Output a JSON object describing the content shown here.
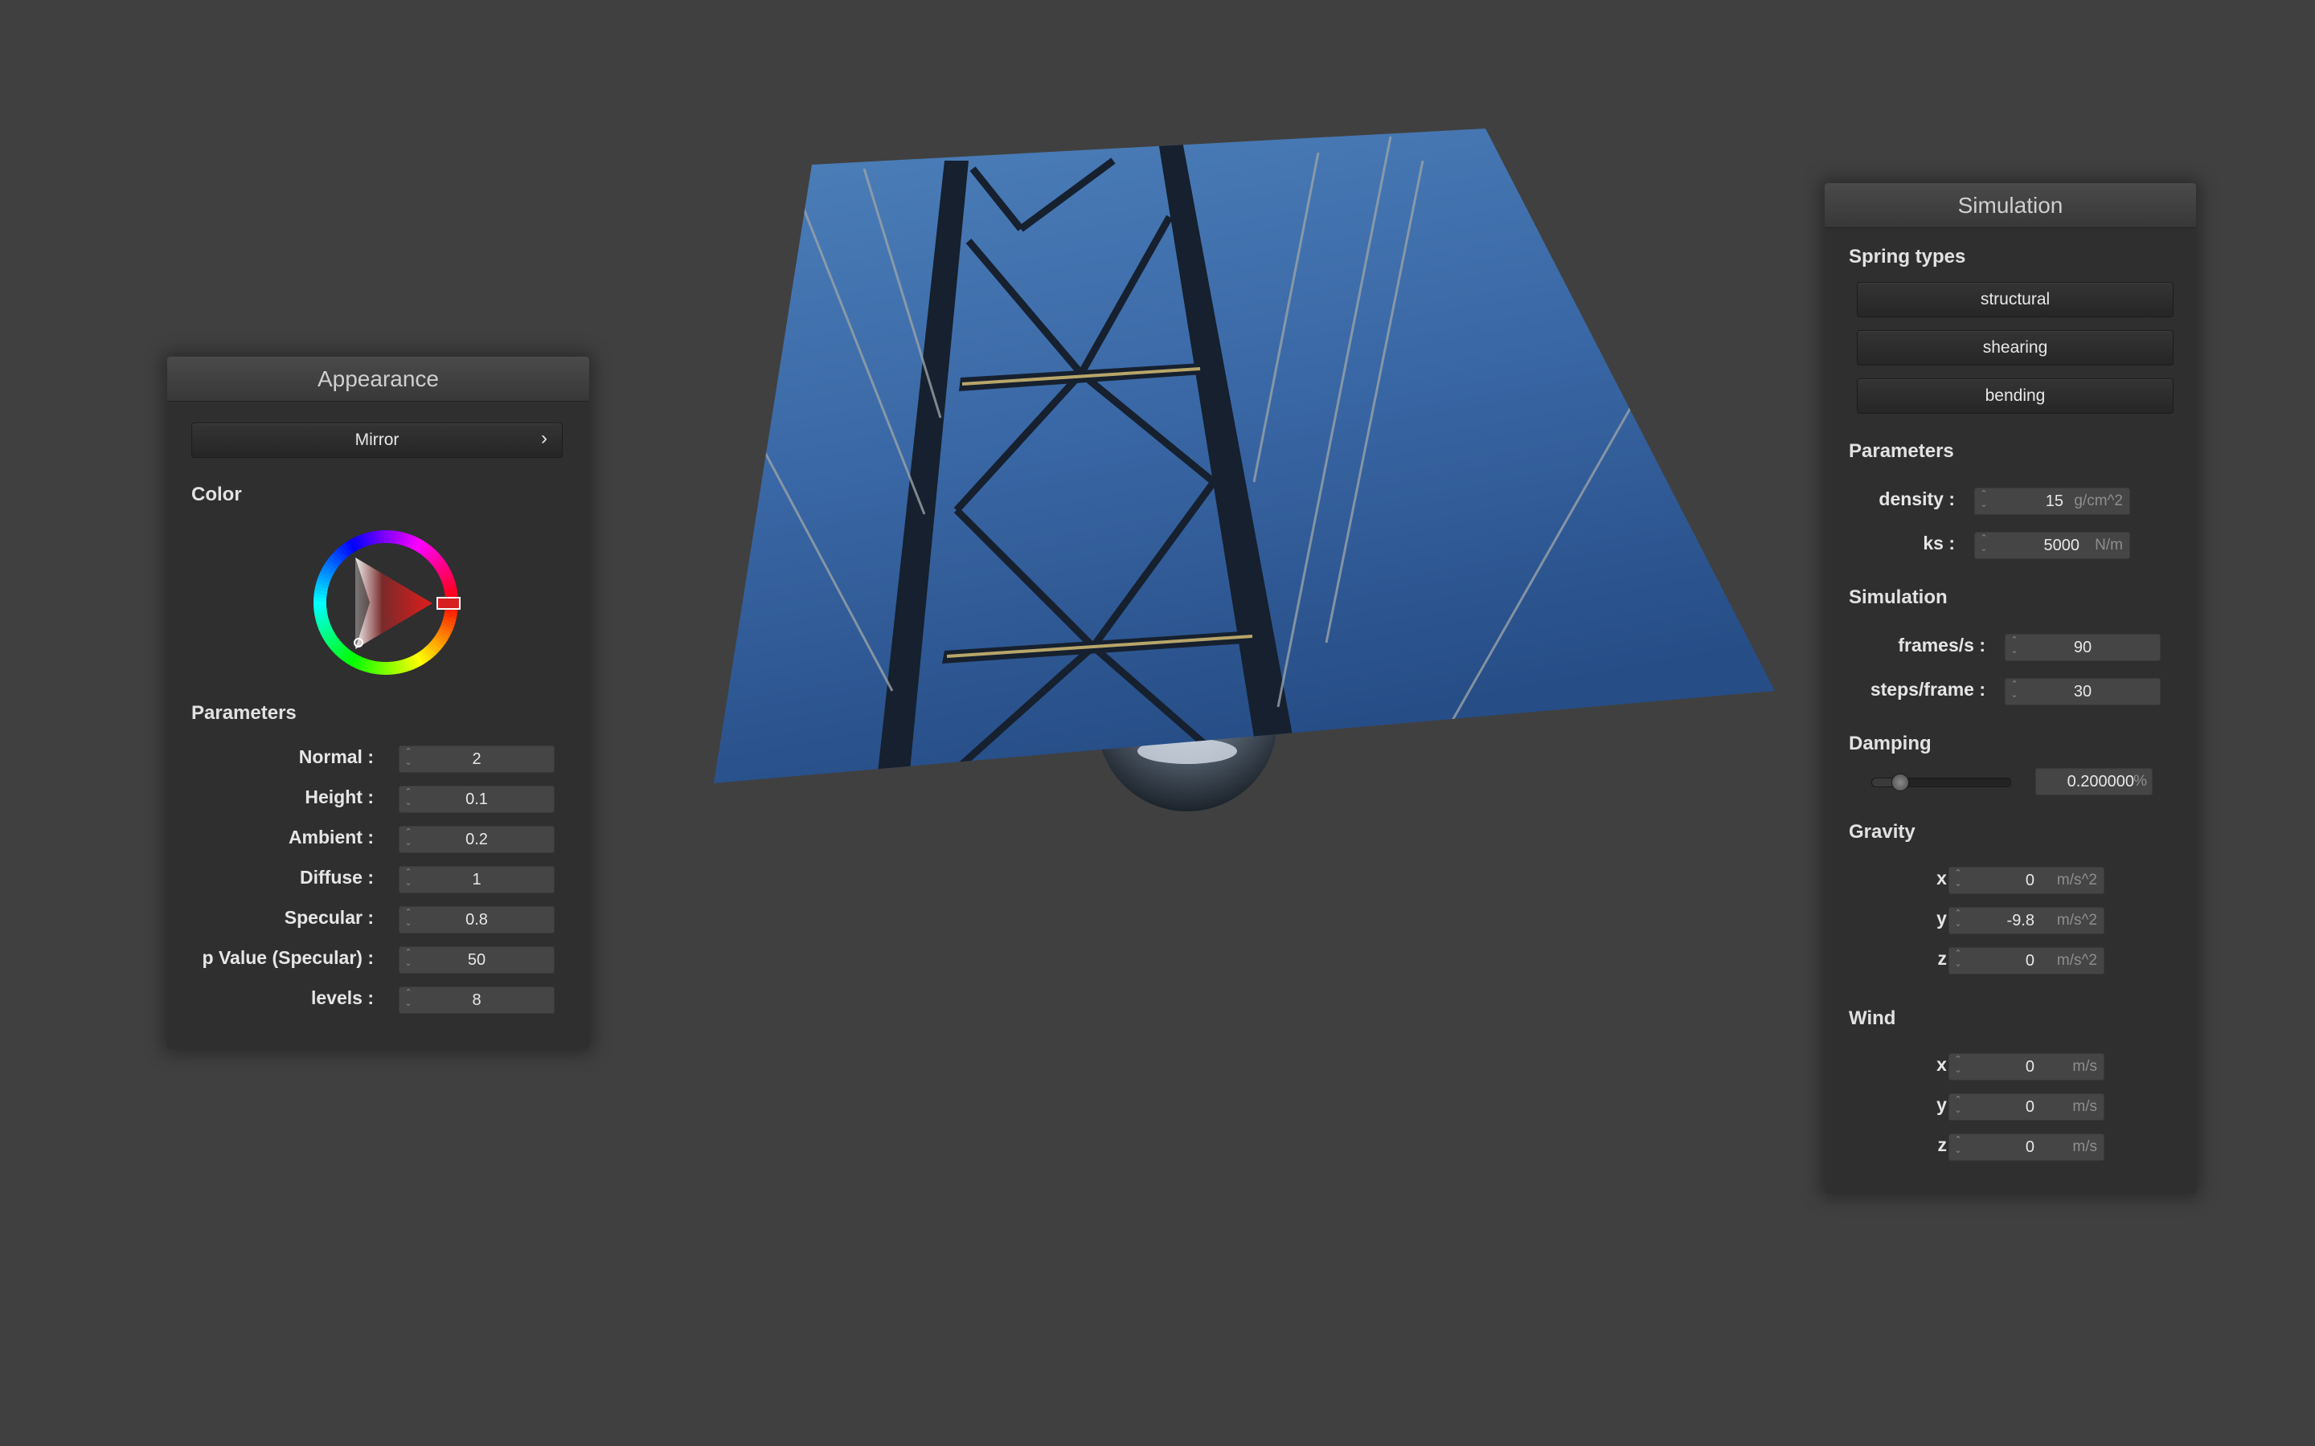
{
  "appearance": {
    "title": "Appearance",
    "mode_label": "Mirror",
    "mode_chevron": "›",
    "color_section": "Color",
    "parameters_section": "Parameters",
    "params": [
      {
        "label": "Normal :",
        "value": "2"
      },
      {
        "label": "Height :",
        "value": "0.1"
      },
      {
        "label": "Ambient :",
        "value": "0.2"
      },
      {
        "label": "Diffuse :",
        "value": "1"
      },
      {
        "label": "Specular :",
        "value": "0.8"
      },
      {
        "label": "p Value (Specular) :",
        "value": "50"
      },
      {
        "label": "levels :",
        "value": "8"
      }
    ],
    "selected_color": "#d62020"
  },
  "simulation": {
    "title": "Simulation",
    "spring_section": "Spring types",
    "spring_buttons": [
      "structural",
      "shearing",
      "bending"
    ],
    "parameters_section": "Parameters",
    "density": {
      "label": "density :",
      "value": "15",
      "unit": "g/cm^2"
    },
    "ks": {
      "label": "ks :",
      "value": "5000",
      "unit": "N/m"
    },
    "sim_section": "Simulation",
    "fps": {
      "label": "frames/s :",
      "value": "90"
    },
    "steps": {
      "label": "steps/frame :",
      "value": "30"
    },
    "damping_section": "Damping",
    "damping": {
      "value": "0.200000",
      "unit": "%",
      "level": 0.2
    },
    "gravity_section": "Gravity",
    "gravity": [
      {
        "label": "x :",
        "value": "0",
        "unit": "m/s^2"
      },
      {
        "label": "y :",
        "value": "-9.8",
        "unit": "m/s^2"
      },
      {
        "label": "z :",
        "value": "0",
        "unit": "m/s^2"
      }
    ],
    "wind_section": "Wind",
    "wind": [
      {
        "label": "x :",
        "value": "0",
        "unit": "m/s"
      },
      {
        "label": "y :",
        "value": "0",
        "unit": "m/s"
      },
      {
        "label": "z :",
        "value": "0",
        "unit": "m/s"
      }
    ]
  },
  "colors": {
    "background": "#404040",
    "panel": "#2f2f2f",
    "sky": "#2f5a96"
  }
}
